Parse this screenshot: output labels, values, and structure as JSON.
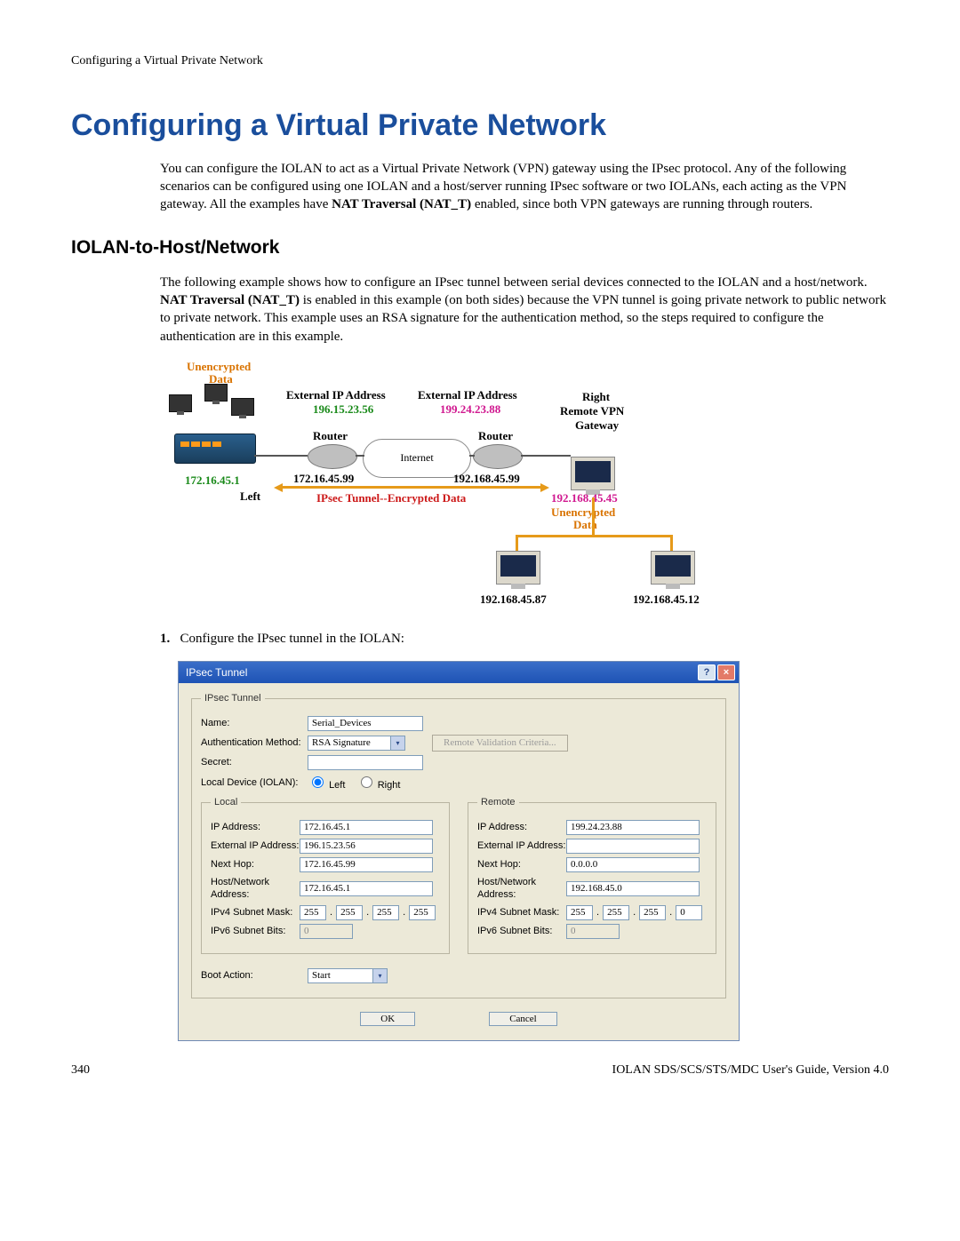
{
  "header": {
    "running": "Configuring a Virtual Private Network"
  },
  "title": "Configuring a Virtual Private Network",
  "intro": {
    "p1_a": "You can configure the IOLAN to act as a Virtual Private Network (VPN) gateway using the IPsec protocol. Any of the following scenarios can be configured using one IOLAN and a host/server running IPsec software or two IOLANs, each acting as the VPN gateway. All the examples have ",
    "p1_b": "NAT Traversal (NAT_T)",
    "p1_c": " enabled, since both VPN gateways are running through routers."
  },
  "h2": "IOLAN-to-Host/Network",
  "intro2": {
    "a": "The following example shows how to configure an IPsec tunnel between serial devices connected to the IOLAN and a host/network. ",
    "b": "NAT Traversal (NAT_T)",
    "c": " is enabled in this example (on both sides) because the VPN tunnel is going private network to public network to private network. This example uses an RSA signature for the authentication method, so the steps required to configure the authentication are in this example."
  },
  "diagram": {
    "unenc1": "Unencrypted",
    "data1": "Data",
    "ext_ip_l_label": "External IP Address",
    "ext_ip_l_val": "196.15.23.56",
    "ext_ip_r_label": "External IP Address",
    "ext_ip_r_val": "199.24.23.88",
    "right": "Right",
    "remote_vpn": "Remote VPN",
    "gateway": "Gateway",
    "router_l": "Router",
    "router_r": "Router",
    "internet": "Internet",
    "ip_left_local": "172.16.45.1",
    "ip_left_hop": "172.16.45.99",
    "ip_right_hop": "192.168.45.99",
    "left": "Left",
    "ipsec": "IPsec Tunnel--Encrypted Data",
    "ip_rgw": "192.168.45.45",
    "unenc2": "Unencrypted",
    "data2": "Data",
    "ip_h1": "192.168.45.87",
    "ip_h2": "192.168.45.12"
  },
  "step1": {
    "n": "1.",
    "t": "Configure the IPsec tunnel in the IOLAN:"
  },
  "dialog": {
    "title": "IPsec Tunnel",
    "group": "IPsec Tunnel",
    "name_lbl": "Name:",
    "name_val": "Serial_Devices",
    "auth_lbl": "Authentication Method:",
    "auth_val": "RSA Signature",
    "remote_btn": "Remote Validation Criteria...",
    "secret_lbl": "Secret:",
    "localdev_lbl": "Local Device (IOLAN):",
    "radio_left": "Left",
    "radio_right": "Right",
    "local_legend": "Local",
    "remote_legend": "Remote",
    "ip_lbl": "IP Address:",
    "ext_lbl": "External IP Address:",
    "hop_lbl": "Next Hop:",
    "hn_lbl": "Host/Network Address:",
    "v4_lbl": "IPv4 Subnet Mask:",
    "v6_lbl": "IPv6 Subnet Bits:",
    "local": {
      "ip": "172.16.45.1",
      "ext": "196.15.23.56",
      "hop": "172.16.45.99",
      "hn": "172.16.45.1",
      "m1": "255",
      "m2": "255",
      "m3": "255",
      "m4": "255",
      "v6": "0"
    },
    "remote": {
      "ip": "199.24.23.88",
      "ext": "",
      "hop": "0.0.0.0",
      "hn": "192.168.45.0",
      "m1": "255",
      "m2": "255",
      "m3": "255",
      "m4": "0",
      "v6": "0"
    },
    "boot_lbl": "Boot Action:",
    "boot_val": "Start",
    "ok": "OK",
    "cancel": "Cancel"
  },
  "footer": {
    "page": "340",
    "doc": "IOLAN SDS/SCS/STS/MDC User's Guide, Version 4.0"
  }
}
